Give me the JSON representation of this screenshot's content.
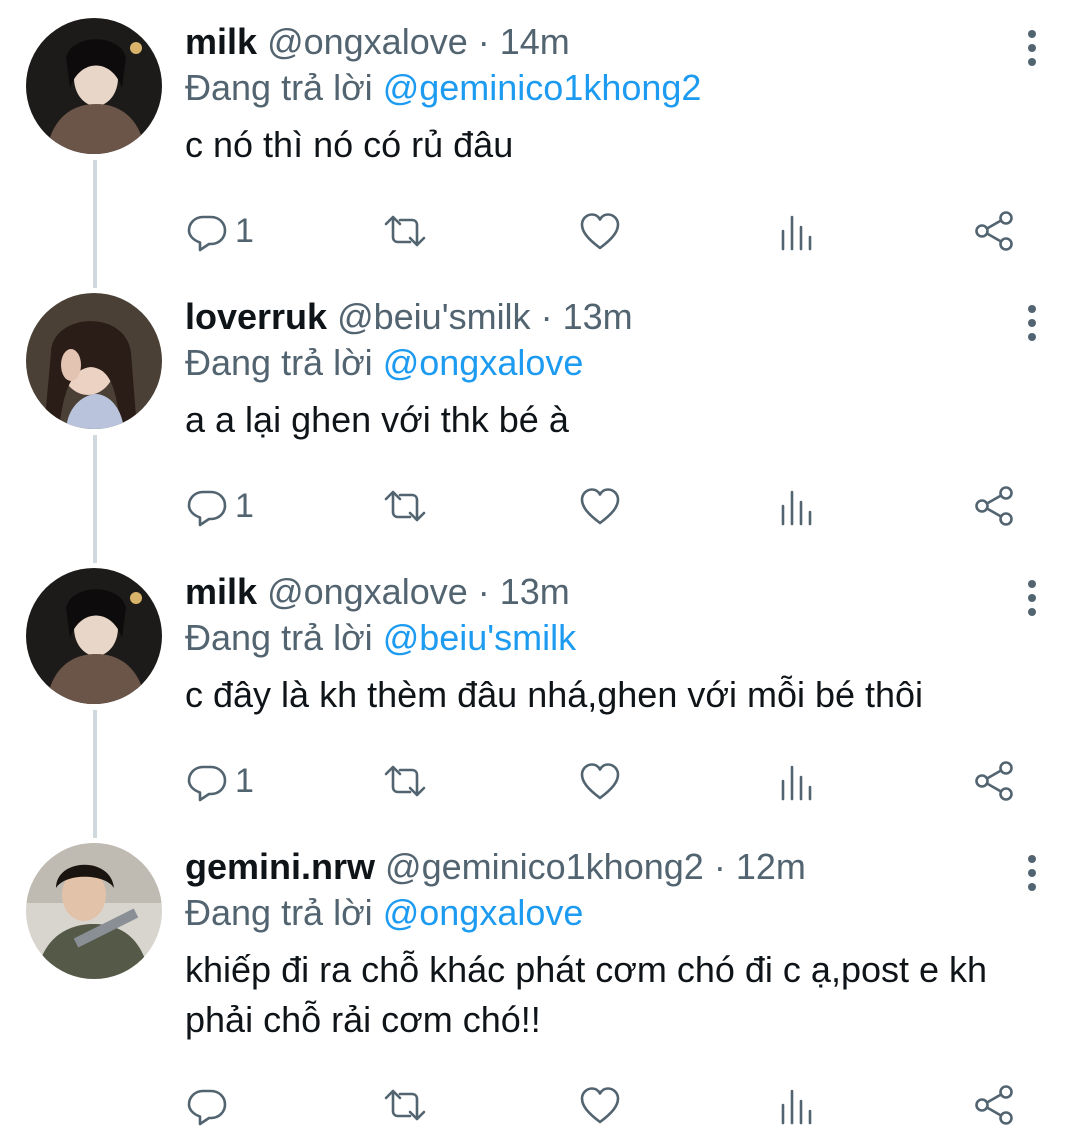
{
  "reply_prefix": "Đang trả lời",
  "separator": "·",
  "tweets": [
    {
      "name": "milk",
      "handle": "@ongxalove",
      "time": "14m",
      "reply_to": "@geminico1khong2",
      "text": "c nó thì nó có rủ đâu",
      "reply_count": "1"
    },
    {
      "name": "loverruk",
      "handle": "@beiu'smilk",
      "time": "13m",
      "reply_to": "@ongxalove",
      "text": "a a lại ghen với thk bé à",
      "reply_count": "1"
    },
    {
      "name": "milk",
      "handle": "@ongxalove",
      "time": "13m",
      "reply_to": "@beiu'smilk",
      "text": "c đây là kh thèm đâu nhá,ghen với mỗi bé thôi",
      "reply_count": "1"
    },
    {
      "name": "gemini.nrw",
      "handle": "@geminico1khong2",
      "time": "12m",
      "reply_to": "@ongxalove",
      "text": "khiếp đi ra chỗ khác phát cơm chó đi c ạ,post e kh phải chỗ rải cơm chó!!",
      "reply_count": ""
    }
  ],
  "colors": {
    "text": "#0f1419",
    "secondary": "#536471",
    "mention": "#1d9bf0",
    "thread_line": "#cfd9de"
  },
  "icons": [
    "reply-icon",
    "retweet-icon",
    "like-icon",
    "views-icon",
    "share-icon",
    "more-icon"
  ]
}
